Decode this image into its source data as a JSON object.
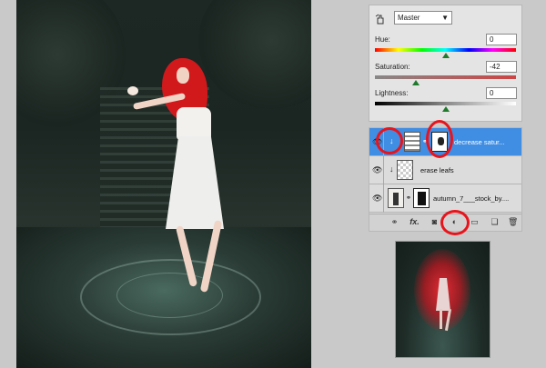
{
  "adjustments": {
    "preset_value": "Master",
    "hue": {
      "label": "Hue:",
      "value": "0",
      "level": 0
    },
    "saturation": {
      "label": "Saturation:",
      "value": "-42",
      "level": -42
    },
    "lightness": {
      "label": "Lightness:",
      "value": "0",
      "level": 0
    }
  },
  "layers": {
    "items": [
      {
        "name": "decrease satur...",
        "selected": true
      },
      {
        "name": "erase leafs",
        "selected": false
      },
      {
        "name": "autumn_7___stock_by....",
        "selected": false
      }
    ],
    "bottom_bar": {
      "fx_label": "fx."
    }
  },
  "colors": {
    "selection_blue": "#3f8ee3",
    "highlight_red": "#e8141c",
    "panel_bg": "#e4e4e4"
  }
}
